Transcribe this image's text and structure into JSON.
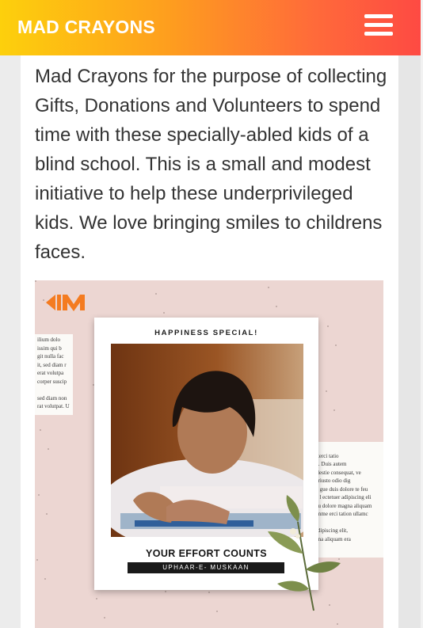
{
  "header": {
    "brand": "MAD CRAYONS",
    "menu_icon": "hamburger-menu-icon"
  },
  "intro_text": "Mad Crayons for the purpose of collecting Gifts, Donations and Volunteers to spend time with these specially-abled kids of a blind school. This is a small and modest initiative to help these underprivileged kids. We love bringing smiles to childrens faces.",
  "poster": {
    "logo": "MC",
    "heading": "HAPPINESS SPECIAL!",
    "cta": "YOUR EFFORT COUNTS",
    "tagline": "UPHAAR-E- MUSKAAN",
    "clip_left": [
      "ilium dolo",
      "issim qui b",
      "git nulla fac",
      "it, sed diam r",
      "erat volutpa",
      "corper suscip",
      "",
      "sed diam non",
      "rat volutpat. U"
    ],
    "clip_right": [
      "eet dolo",
      "ostrud exerci tatio",
      "onsequat. Duis autem",
      "e vel molestie consequat, ve",
      "zzril de iriusto odio dig",
      "e sit ame gue duis dolore te feu",
      "cidunt ut l ectetuer adipiscing eli",
      "venim, qu dolore magna aliquam",
      "ex ea comme erci tation ullamc",
      "",
      "ctetuer adipiscing elit,",
      "iore magna aliquam era"
    ]
  },
  "colors": {
    "header_start": "#fdd00c",
    "header_end": "#fe4a43",
    "body_text": "#333333",
    "poster_bg": "#ecd6d2",
    "logo_orange": "#f47b20"
  }
}
